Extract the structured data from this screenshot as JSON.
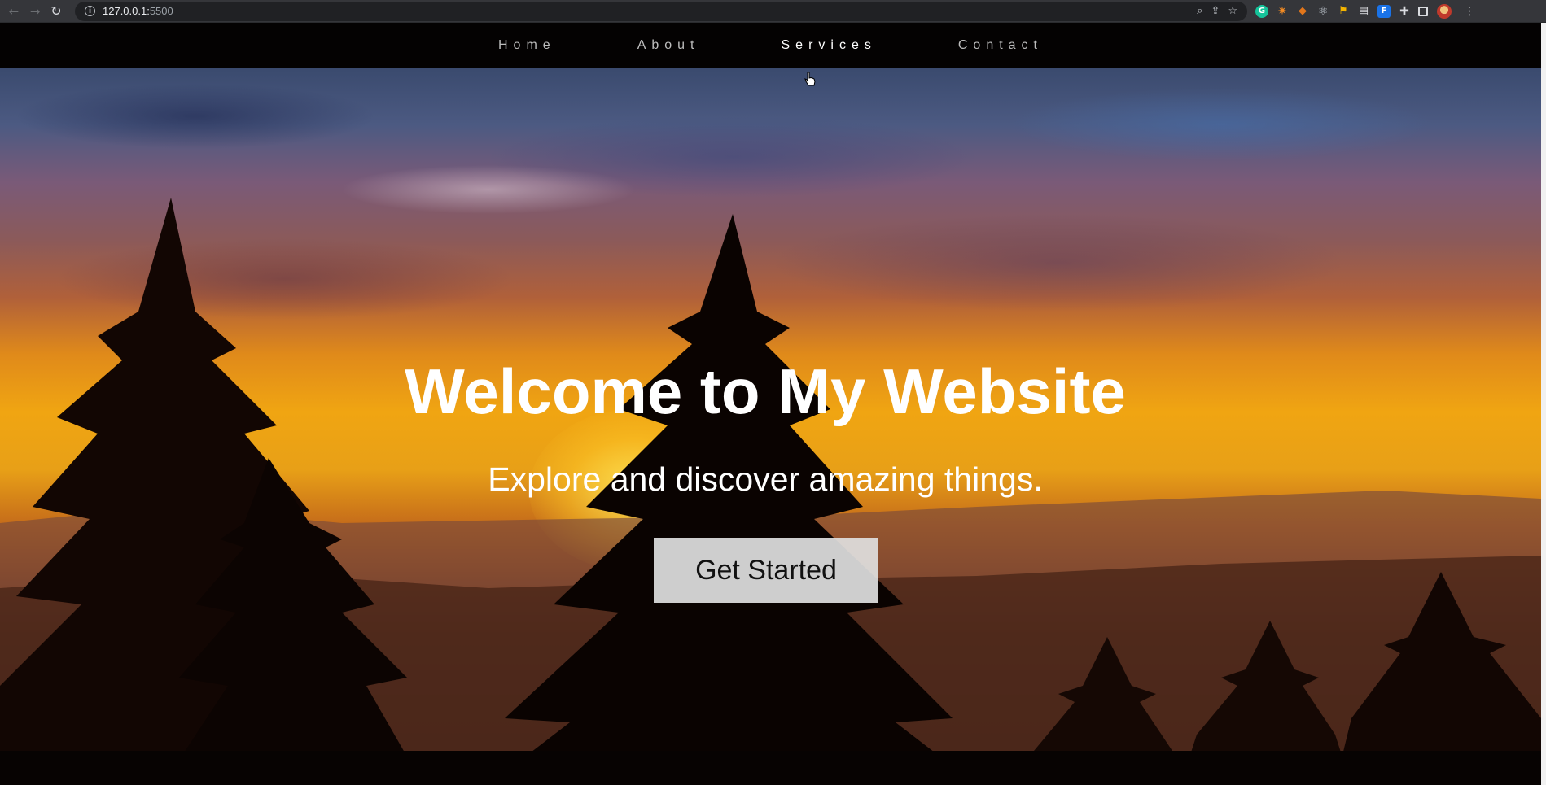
{
  "browser": {
    "url_host": "127.0.0.1:",
    "url_port": "5500"
  },
  "nav": {
    "items": [
      {
        "label": "Home",
        "active": false
      },
      {
        "label": "About",
        "active": false
      },
      {
        "label": "Services",
        "active": true
      },
      {
        "label": "Contact",
        "active": false
      }
    ]
  },
  "hero": {
    "title": "Welcome to My Website",
    "subtitle": "Explore and discover amazing things.",
    "cta_label": "Get Started"
  },
  "colors": {
    "nav_bg": "#040202",
    "nav_text": "#bdbdbd",
    "nav_active": "#ffffff",
    "cta_bg": "#e0e0e0"
  }
}
